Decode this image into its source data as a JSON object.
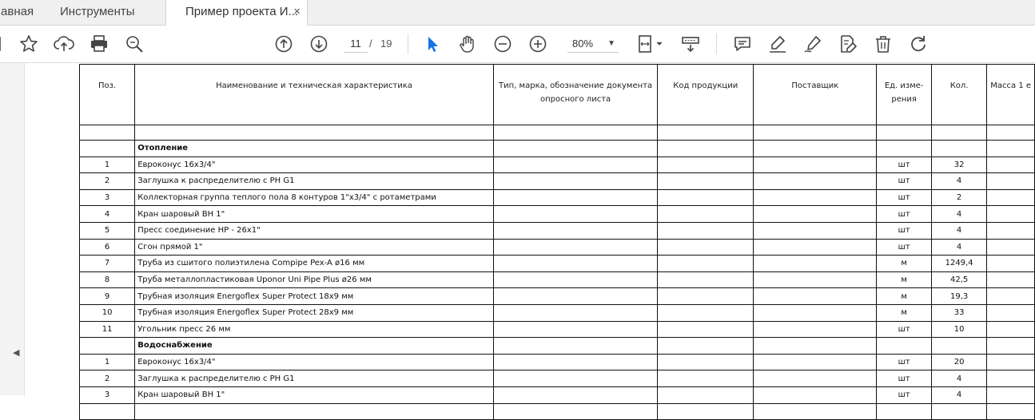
{
  "tabs": [
    {
      "label": "Главная"
    },
    {
      "label": "Инструменты"
    },
    {
      "label": "Пример проекта И..."
    }
  ],
  "close_glyph": "×",
  "toolbar": {
    "page_current": "11",
    "page_sep": "/",
    "page_total": "19",
    "zoom": "80%",
    "accent": "#1473e6",
    "icons": [
      "star-icon",
      "cloud-upload-icon",
      "print-icon",
      "zoom-search-icon",
      "page-up-icon",
      "page-down-icon",
      "select-arrow-icon",
      "hand-icon",
      "zoom-out-icon",
      "zoom-in-icon",
      "fit-page-icon",
      "scroll-mode-icon",
      "comment-icon",
      "highlight-icon",
      "sign-icon",
      "edit-icon",
      "delete-icon",
      "rotate-icon"
    ]
  },
  "table": {
    "headers": [
      "Поз.",
      "Наименование и техническая характеристика",
      "Тип, марка, обозначение документа опросного листа",
      "Код продукции",
      "Поставщик",
      "Ед. изме-рения",
      "Кол.",
      "Масса 1 е"
    ],
    "rows": [
      {
        "type": "spacer",
        "pos": "",
        "name": "",
        "unit": "",
        "qty": ""
      },
      {
        "type": "section",
        "pos": "",
        "name": "Отопление",
        "unit": "",
        "qty": ""
      },
      {
        "type": "item",
        "pos": "1",
        "name": "Евроконус 16х3/4\"",
        "unit": "шт",
        "qty": "32"
      },
      {
        "type": "item",
        "pos": "2",
        "name": "Заглушка к распределителю с РН G1",
        "unit": "шт",
        "qty": "4"
      },
      {
        "type": "item",
        "pos": "3",
        "name": " Коллекторная группа теплого пола 8 контуров 1\"х3/4\" с ротаметрами",
        "unit": "шт",
        "qty": "2"
      },
      {
        "type": "item",
        "pos": "4",
        "name": "Кран шаровый ВН 1\"",
        "unit": "шт",
        "qty": "4"
      },
      {
        "type": "item",
        "pos": "5",
        "name": "Пресс соединение НР - 26х1\"",
        "unit": "шт",
        "qty": "4"
      },
      {
        "type": "item",
        "pos": "6",
        "name": "Сгон прямой 1\"",
        "unit": "шт",
        "qty": "4"
      },
      {
        "type": "item",
        "pos": "7",
        "name": "Труба из сшитого полиэтилена Compipe Pex-A ø16 мм",
        "unit": "м",
        "qty": "1249,4"
      },
      {
        "type": "item",
        "pos": "8",
        "name": "Труба металлопластиковая Uponor Uni Pipe Plus ø26 мм",
        "unit": "м",
        "qty": "42,5"
      },
      {
        "type": "item",
        "pos": "9",
        "name": "Трубная изоляция Energoflex Super Protect 18х9 мм",
        "unit": "м",
        "qty": "19,3"
      },
      {
        "type": "item",
        "pos": "10",
        "name": "Трубная изоляция Energoflex Super Protect 28х9 мм",
        "unit": "м",
        "qty": "33"
      },
      {
        "type": "item",
        "pos": "11",
        "name": "Угольник пресс 26 мм",
        "unit": "шт",
        "qty": "10"
      },
      {
        "type": "section",
        "pos": "",
        "name": "Водоснабжение",
        "unit": "",
        "qty": ""
      },
      {
        "type": "item",
        "pos": "1",
        "name": "Евроконус 16х3/4\"",
        "unit": "шт",
        "qty": "20"
      },
      {
        "type": "item",
        "pos": "2",
        "name": "Заглушка к распределителю с РН G1",
        "unit": "шт",
        "qty": "4"
      },
      {
        "type": "item",
        "pos": "3",
        "name": "Кран шаровый ВН 1\"",
        "unit": "шт",
        "qty": "4"
      },
      {
        "type": "item",
        "pos": "",
        "name": "",
        "unit": "",
        "qty": ""
      }
    ]
  }
}
